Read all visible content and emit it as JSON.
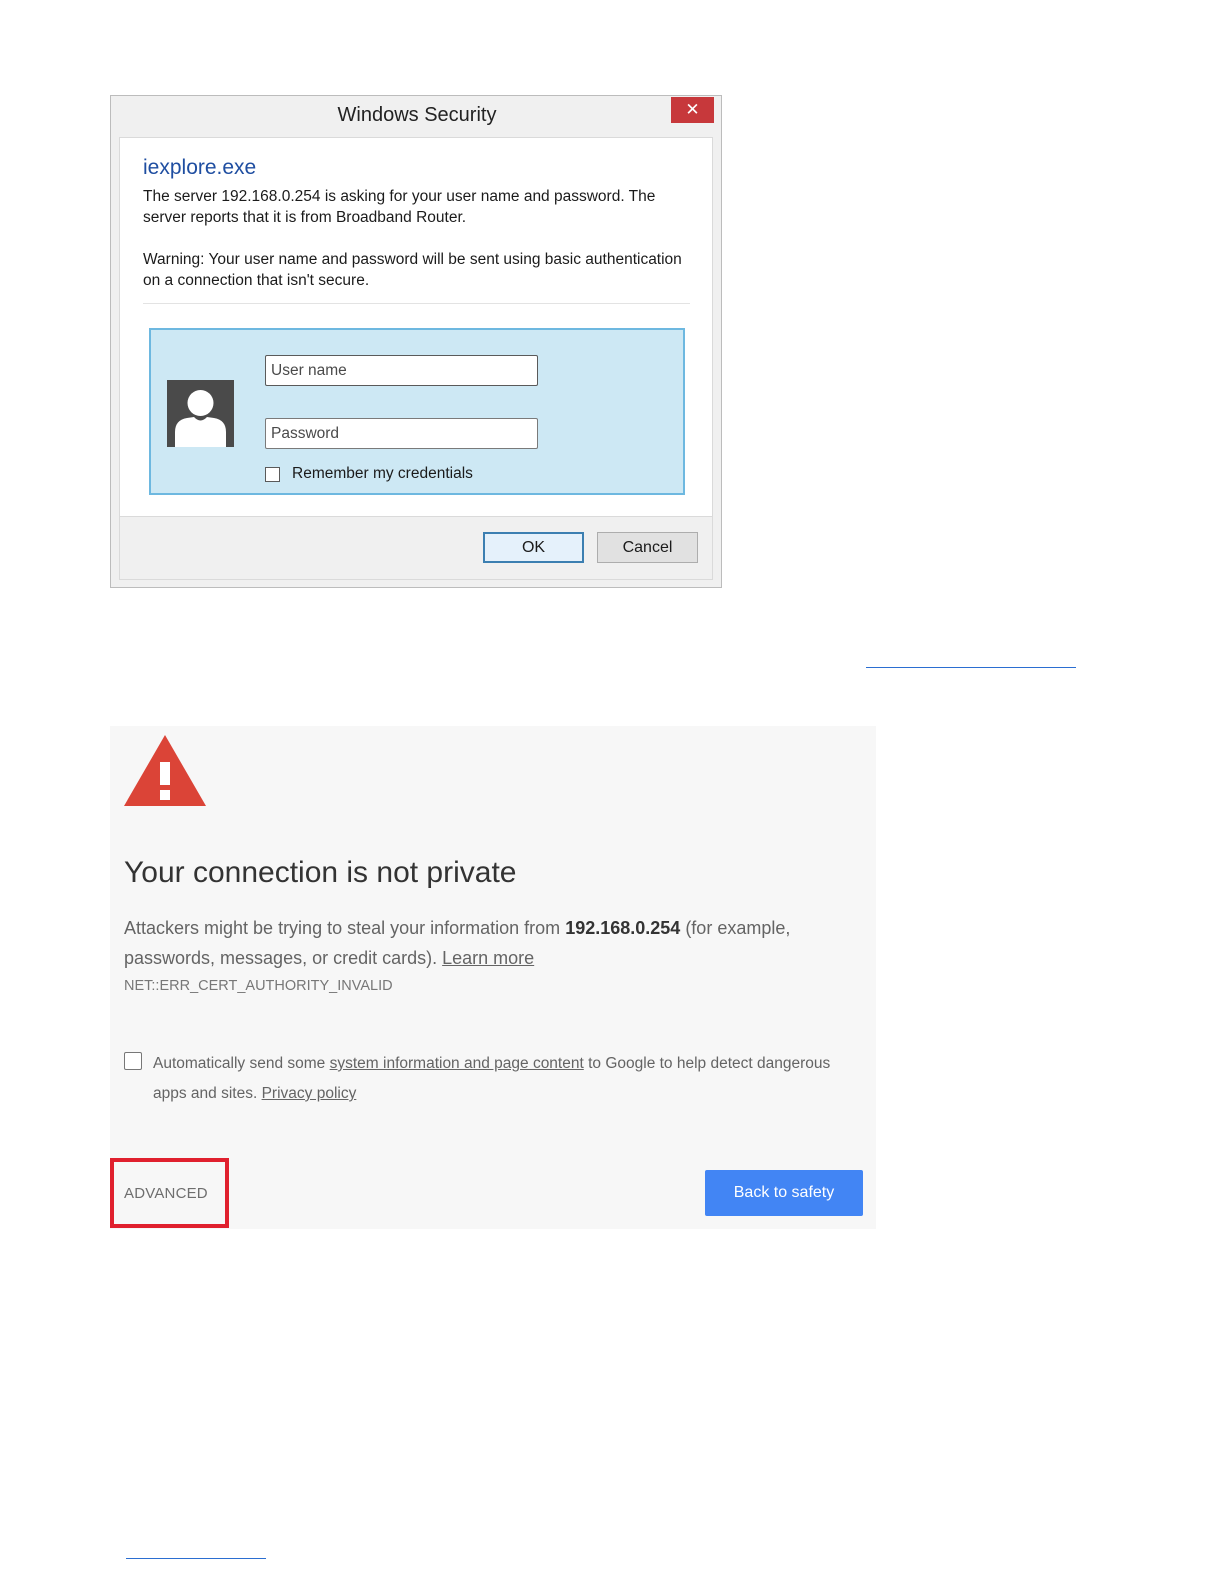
{
  "windows_dialog": {
    "title": "Windows Security",
    "close_glyph": "✕",
    "app_name": "iexplore.exe",
    "server_message": "The server 192.168.0.254 is asking for your user name and password. The server reports that it is from Broadband Router.",
    "warning_message": "Warning: Your user name and password will be sent using basic authentication on a connection that isn't secure.",
    "username": {
      "placeholder": "User name",
      "value": ""
    },
    "password": {
      "placeholder": "Password",
      "value": ""
    },
    "remember_label": "Remember my credentials",
    "remember_checked": false,
    "ok_label": "OK",
    "cancel_label": "Cancel",
    "colors": {
      "close": "#c7383b",
      "app_name": "#1f4ea1",
      "credential_box": "#cde8f4"
    }
  },
  "chrome_interstitial": {
    "heading": "Your connection is not private",
    "para_pre": "Attackers might be trying to steal your information from ",
    "host": "192.168.0.254",
    "para_post": " (for example, passwords, messages, or credit cards). ",
    "learn_more": "Learn more",
    "error_code": "NET::ERR_CERT_AUTHORITY_INVALID",
    "option_pre": "Automatically send some ",
    "option_link": "system information and page content",
    "option_mid": " to Google to help detect dangerous apps and sites. ",
    "privacy_link": "Privacy policy",
    "option_checked": false,
    "advanced_label": "ADVANCED",
    "back_label": "Back to safety",
    "colors": {
      "warning_icon": "#db4437",
      "primary_button": "#4285f4",
      "highlight": "#e0202e"
    }
  }
}
